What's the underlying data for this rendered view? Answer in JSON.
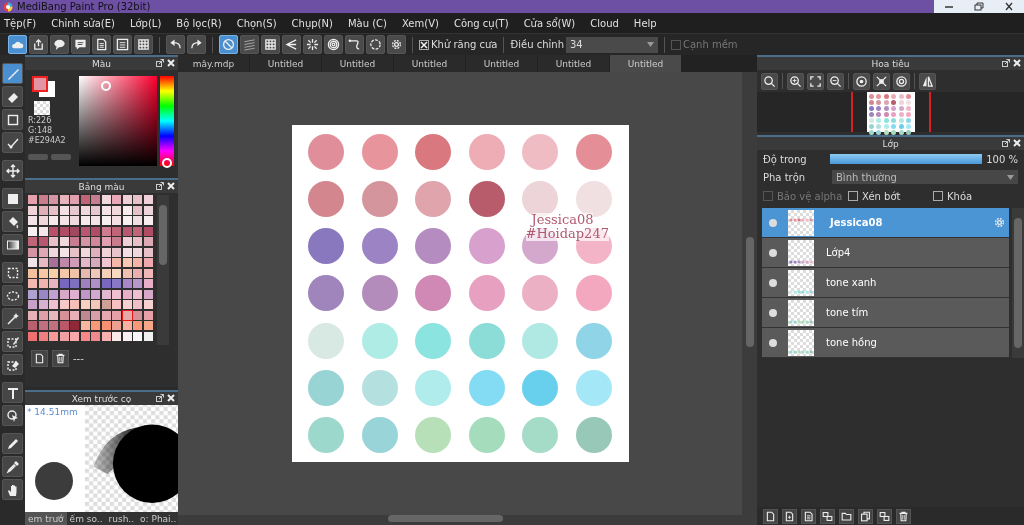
{
  "window": {
    "title": "MediBang Paint Pro (32bit)"
  },
  "menu": [
    "Tệp(F)",
    "Chỉnh sửa(E)",
    "Lớp(L)",
    "Bộ lọc(R)",
    "Chọn(S)",
    "Chụp(N)",
    "Màu (C)",
    "Xem(V)",
    "Công cụ(T)",
    "Cửa sổ(W)",
    "Cloud",
    "Help"
  ],
  "toolbar": {
    "buttons": [
      {
        "selected": true
      },
      {
        "selected": false
      },
      {
        "selected": false
      },
      {
        "selected": false
      },
      {
        "selected": false
      },
      {
        "selected": false
      },
      {
        "selected": false
      },
      {
        "selected": false
      },
      {
        "selected": false
      },
      {
        "selected": true
      },
      {
        "selected": false
      },
      {
        "selected": false
      },
      {
        "selected": false
      },
      {
        "selected": false
      },
      {
        "selected": false
      },
      {
        "selected": false
      },
      {
        "selected": false
      },
      {
        "selected": false
      }
    ],
    "antialias": {
      "label": "Khử răng cưa",
      "checked": true
    },
    "correction": {
      "label": "Điều chỉnh",
      "value": "34"
    },
    "soft_edge": {
      "label": "Cạnh mềm",
      "checked": false,
      "disabled": true
    }
  },
  "tools": [
    {
      "selected": true
    },
    {
      "selected": false
    },
    {
      "selected": false
    },
    {
      "selected": false
    },
    {
      "selected": false
    },
    {
      "selected": false
    },
    {
      "selected": false
    },
    {
      "selected": false
    },
    {
      "selected": false
    },
    {
      "selected": false
    },
    {
      "selected": false
    },
    {
      "selected": false
    },
    {
      "selected": false
    },
    {
      "selected": false
    },
    {
      "selected": false
    },
    {
      "selected": false
    },
    {
      "selected": false
    },
    {
      "selected": false
    }
  ],
  "color_panel": {
    "title": "Màu",
    "color": "#e294a2",
    "r": "R:226",
    "g": "G:148",
    "hex": "#E294A2"
  },
  "palette_panel": {
    "title": "Bảng màu",
    "footer": "---",
    "rows": [
      [
        {
          "color": "#e6a0ac",
          "selected": false
        },
        {
          "color": "#c87c8c",
          "selected": false
        },
        {
          "color": "#d494a4",
          "selected": false
        },
        {
          "color": "#e8b4bc",
          "selected": false
        },
        {
          "color": "#e0a0b0",
          "selected": false
        },
        {
          "color": "#c06478",
          "selected": false
        },
        {
          "color": "#c87c90",
          "selected": false
        },
        {
          "color": "#f0d8dc",
          "selected": false
        },
        {
          "color": "#e8a8b8",
          "selected": false
        },
        {
          "color": "#f0d0d8",
          "selected": false
        },
        {
          "color": "#e8c0c8",
          "selected": false
        },
        {
          "color": "#f0d0d8",
          "selected": false
        }
      ],
      [
        {
          "color": "#f0d4d8",
          "selected": false
        },
        {
          "color": "#e0b0b8",
          "selected": false
        },
        {
          "color": "#e8c0c8",
          "selected": false
        },
        {
          "color": "#f4e0e4",
          "selected": false
        },
        {
          "color": "#e8c8d0",
          "selected": false
        },
        {
          "color": "#f0d8dc",
          "selected": false
        },
        {
          "color": "#e8c8d0",
          "selected": false
        },
        {
          "color": "#f4e4e8",
          "selected": false
        },
        {
          "color": "#f0d8dc",
          "selected": false
        },
        {
          "color": "#f8ecee",
          "selected": false
        },
        {
          "color": "#e8c0c8",
          "selected": false
        },
        {
          "color": "#f0d4dc",
          "selected": false
        }
      ],
      [
        {
          "color": "#f4e4e8",
          "selected": false
        },
        {
          "color": "#f0d8dc",
          "selected": false
        },
        {
          "color": "#f8eaec",
          "selected": false
        },
        {
          "color": "#f4e4e8",
          "selected": false
        },
        {
          "color": "#f0dce0",
          "selected": false
        },
        {
          "color": "#f8eaec",
          "selected": false
        },
        {
          "color": "#f4e4e8",
          "selected": false
        },
        {
          "color": "#f8f0f0",
          "selected": false
        },
        {
          "color": "#f4e0e4",
          "selected": false
        },
        {
          "color": "#f8f0f2",
          "selected": false
        },
        {
          "color": "#f0e0e4",
          "selected": false
        },
        {
          "color": "#f8eef0",
          "selected": false
        }
      ],
      [
        {
          "color": "#f8f0f2",
          "selected": false
        },
        {
          "color": "#f4e8ea",
          "selected": false
        },
        {
          "color": "#b85068",
          "selected": false
        },
        {
          "color": "#b04c64",
          "selected": false
        },
        {
          "color": "#a04860",
          "selected": false
        },
        {
          "color": "#b85870",
          "selected": false
        },
        {
          "color": "#b04c64",
          "selected": false
        },
        {
          "color": "#d07c90",
          "selected": false
        },
        {
          "color": "#c06478",
          "selected": false
        },
        {
          "color": "#b85870",
          "selected": false
        },
        {
          "color": "#c06478",
          "selected": false
        },
        {
          "color": "#b04c64",
          "selected": false
        }
      ],
      [
        {
          "color": "#c06478",
          "selected": false
        },
        {
          "color": "#b85870",
          "selected": false
        },
        {
          "color": "#e8c0c8",
          "selected": false
        },
        {
          "color": "#f0d8dc",
          "selected": false
        },
        {
          "color": "#c87c90",
          "selected": false
        },
        {
          "color": "#d494a4",
          "selected": false
        },
        {
          "color": "#d08898",
          "selected": false
        },
        {
          "color": "#e0a0b0",
          "selected": false
        },
        {
          "color": "#c87c8c",
          "selected": false
        },
        {
          "color": "#f0d0d8",
          "selected": false
        },
        {
          "color": "#e8c0c8",
          "selected": false
        },
        {
          "color": "#e0a8b4",
          "selected": false
        }
      ],
      [
        {
          "color": "#d494a4",
          "selected": false
        },
        {
          "color": "#e0a8b4",
          "selected": false
        },
        {
          "color": "#f0d8dc",
          "selected": false
        },
        {
          "color": "#f4e4e8",
          "selected": false
        },
        {
          "color": "#e8c0c8",
          "selected": false
        },
        {
          "color": "#f0d8dc",
          "selected": false
        },
        {
          "color": "#e0b0bc",
          "selected": false
        },
        {
          "color": "#f0d4d8",
          "selected": false
        },
        {
          "color": "#e8c4cc",
          "selected": false
        },
        {
          "color": "#f4e0e4",
          "selected": false
        },
        {
          "color": "#f0d8dc",
          "selected": false
        },
        {
          "color": "#e8c0c8",
          "selected": false
        }
      ],
      [
        {
          "color": "#f0e4e8",
          "selected": false
        },
        {
          "color": "#e8b8c4",
          "selected": false
        },
        {
          "color": "#a87098",
          "selected": false
        },
        {
          "color": "#c088a8",
          "selected": false
        },
        {
          "color": "#d09cb8",
          "selected": false
        },
        {
          "color": "#e4b8c8",
          "selected": false
        },
        {
          "color": "#d8a8bc",
          "selected": false
        },
        {
          "color": "#f0c4d0",
          "selected": false
        },
        {
          "color": "#f4b8a8",
          "selected": false
        },
        {
          "color": "#f8c8b4",
          "selected": false
        },
        {
          "color": "#f4b4a8",
          "selected": false
        },
        {
          "color": "#f0a8b0",
          "selected": false
        }
      ],
      [
        {
          "color": "#f4c0a0",
          "selected": false
        },
        {
          "color": "#f8c8a4",
          "selected": false
        },
        {
          "color": "#f8d0a8",
          "selected": false
        },
        {
          "color": "#f4c8a8",
          "selected": false
        },
        {
          "color": "#f0c4a8",
          "selected": false
        },
        {
          "color": "#e8b8b0",
          "selected": false
        },
        {
          "color": "#f0c8b8",
          "selected": false
        },
        {
          "color": "#f4d0b8",
          "selected": false
        },
        {
          "color": "#f8d8c0",
          "selected": false
        },
        {
          "color": "#f0c0b0",
          "selected": false
        },
        {
          "color": "#e8b0b0",
          "selected": false
        },
        {
          "color": "#f0b8b8",
          "selected": false
        }
      ],
      [
        {
          "color": "#f4b8b0",
          "selected": false
        },
        {
          "color": "#f0b4b0",
          "selected": false
        },
        {
          "color": "#e8b4c0",
          "selected": false
        },
        {
          "color": "#7868c0",
          "selected": false
        },
        {
          "color": "#8070c0",
          "selected": false
        },
        {
          "color": "#a080c0",
          "selected": false
        },
        {
          "color": "#b090c8",
          "selected": false
        },
        {
          "color": "#7868c0",
          "selected": false
        },
        {
          "color": "#8878c8",
          "selected": false
        },
        {
          "color": "#a888c8",
          "selected": false
        },
        {
          "color": "#b898c8",
          "selected": false
        },
        {
          "color": "#e8b0c8",
          "selected": false
        }
      ],
      [
        {
          "color": "#b0a0d0",
          "selected": false
        },
        {
          "color": "#9888c8",
          "selected": false
        },
        {
          "color": "#c0a0d0",
          "selected": false
        },
        {
          "color": "#d8a8c8",
          "selected": false
        },
        {
          "color": "#e0b0d0",
          "selected": false
        },
        {
          "color": "#c098c8",
          "selected": false
        },
        {
          "color": "#d0a8d0",
          "selected": false
        },
        {
          "color": "#e0b8d0",
          "selected": false
        },
        {
          "color": "#f0c0d0",
          "selected": false
        },
        {
          "color": "#e8b0c8",
          "selected": false
        },
        {
          "color": "#f0c0d0",
          "selected": false
        },
        {
          "color": "#d8a8c8",
          "selected": false
        }
      ],
      [
        {
          "color": "#c8a0c8",
          "selected": false
        },
        {
          "color": "#d8b0d0",
          "selected": false
        },
        {
          "color": "#f0c0d0",
          "selected": false
        },
        {
          "color": "#f8c8c8",
          "selected": false
        },
        {
          "color": "#f4c0b8",
          "selected": false
        },
        {
          "color": "#f8d0c0",
          "selected": false
        },
        {
          "color": "#f4c8b8",
          "selected": false
        },
        {
          "color": "#d0a098",
          "selected": false
        },
        {
          "color": "#f8c0c0",
          "selected": false
        },
        {
          "color": "#f8d0d0",
          "selected": false
        },
        {
          "color": "#f0c0c8",
          "selected": false
        },
        {
          "color": "#f8d0d0",
          "selected": false
        }
      ],
      [
        {
          "color": "#e8b0b8",
          "selected": false
        },
        {
          "color": "#e0a0a8",
          "selected": false
        },
        {
          "color": "#e8b8c0",
          "selected": false
        },
        {
          "color": "#d89098",
          "selected": false
        },
        {
          "color": "#e8b0b8",
          "selected": false
        },
        {
          "color": "#c08890",
          "selected": false
        },
        {
          "color": "#d8a0a8",
          "selected": false
        },
        {
          "color": "#e8a8b0",
          "selected": false
        },
        {
          "color": "#e8a0a8",
          "selected": false
        },
        {
          "color": "#e8a8a8",
          "selected": true
        },
        {
          "color": "#d89098",
          "selected": false
        },
        {
          "color": "#e8a0a8",
          "selected": false
        }
      ],
      [
        {
          "color": "#b8606c",
          "selected": false
        },
        {
          "color": "#c07080",
          "selected": false
        },
        {
          "color": "#c07080",
          "selected": false
        },
        {
          "color": "#b85868",
          "selected": false
        },
        {
          "color": "#902838",
          "selected": false
        },
        {
          "color": "#f8b8a0",
          "selected": false
        },
        {
          "color": "#f89878",
          "selected": false
        },
        {
          "color": "#f89070",
          "selected": false
        },
        {
          "color": "#f0a090",
          "selected": false
        },
        {
          "color": "#f8b0a0",
          "selected": false
        },
        {
          "color": "#f89878",
          "selected": false
        },
        {
          "color": "#f8a888",
          "selected": false
        }
      ],
      [
        {
          "color": "#f07070",
          "selected": false
        },
        {
          "color": "#f08080",
          "selected": false
        },
        {
          "color": "#f89898",
          "selected": false
        },
        {
          "color": "#f0a0a0",
          "selected": false
        },
        {
          "color": "#f8a8a8",
          "selected": false
        },
        {
          "color": "#f88888",
          "selected": false
        },
        {
          "color": "#f08890",
          "selected": false
        },
        {
          "color": "#f8b0b0",
          "selected": false
        },
        {
          "color": "#f8e8e8",
          "selected": false
        },
        {
          "color": "#f8f0f0",
          "selected": false
        },
        {
          "color": "#f8f8f8",
          "selected": false
        },
        {
          "color": "#f0f0f0",
          "selected": false
        }
      ]
    ]
  },
  "brush_preview": {
    "title": "Xem trước cọ",
    "size": "* 14.51mm"
  },
  "left_tabs": [
    {
      "label": "em trướ",
      "selected": true
    },
    {
      "label": "ếm so..",
      "selected": false
    },
    {
      "label": "rush..",
      "selected": false
    },
    {
      "label": "o: Phai..",
      "selected": false
    }
  ],
  "documents": [
    {
      "label": "mây.mdp",
      "selected": false
    },
    {
      "label": "Untitled",
      "selected": false
    },
    {
      "label": "Untitled",
      "selected": false
    },
    {
      "label": "Untitled",
      "selected": false
    },
    {
      "label": "Untitled",
      "selected": false
    },
    {
      "label": "Untitled",
      "selected": false
    },
    {
      "label": "Untitled",
      "selected": true
    }
  ],
  "canvas": {
    "signature": [
      "Jessica08",
      "#Hoidap247"
    ],
    "dots": [
      [
        {
          "color": "#e08e9a"
        },
        {
          "color": "#e8949c"
        },
        {
          "color": "#d9787f"
        },
        {
          "color": "#eeacb4"
        },
        {
          "color": "#f0bcc4"
        },
        {
          "color": "#e48e98"
        }
      ],
      [
        {
          "color": "#d4868f"
        },
        {
          "color": "#d4969c"
        },
        {
          "color": "#e0a4ac"
        },
        {
          "color": "#b85c6c"
        },
        {
          "color": "#ecd4d8"
        },
        {
          "color": "#f0e0e2"
        }
      ],
      [
        {
          "color": "#8a78be"
        },
        {
          "color": "#9c84c4"
        },
        {
          "color": "#b48cc0"
        },
        {
          "color": "#d8a0cc"
        },
        {
          "color": "#d4a8cc"
        },
        {
          "color": "#f4b4c8"
        }
      ],
      [
        {
          "color": "#a084bc"
        },
        {
          "color": "#b48cbc"
        },
        {
          "color": "#d088b4"
        },
        {
          "color": "#e8a0c0"
        },
        {
          "color": "#ecb0c4"
        },
        {
          "color": "#f4a8c0"
        }
      ],
      [
        {
          "color": "#d8e8e2"
        },
        {
          "color": "#b0ece6"
        },
        {
          "color": "#8ce4e0"
        },
        {
          "color": "#8cdcd8"
        },
        {
          "color": "#b0e8e4"
        },
        {
          "color": "#90d4e8"
        }
      ],
      [
        {
          "color": "#98d4d4"
        },
        {
          "color": "#b4e0e0"
        },
        {
          "color": "#b0ecec"
        },
        {
          "color": "#84dcf4"
        },
        {
          "color": "#68d0ec"
        },
        {
          "color": "#a4e8f8"
        }
      ],
      [
        {
          "color": "#9cd8cc"
        },
        {
          "color": "#98d4d8"
        },
        {
          "color": "#b8e0b8"
        },
        {
          "color": "#a4dcbc"
        },
        {
          "color": "#a4dcc8"
        },
        {
          "color": "#98c8b8"
        }
      ]
    ]
  },
  "navigator": {
    "title": "Hoa tiêu"
  },
  "layers_panel": {
    "title": "Lớp",
    "opacity": {
      "label": "Độ trong",
      "level": 1,
      "value": "100 %"
    },
    "blend": {
      "label": "Pha trộn",
      "value": "Bình thường"
    },
    "options": [
      {
        "label": "Bảo vệ alpha",
        "checked": false,
        "disabled": true
      },
      {
        "label": "Xén bớt",
        "checked": false,
        "disabled": false
      },
      {
        "label": "Khóa",
        "checked": false,
        "disabled": false
      }
    ],
    "layers": [
      {
        "name": "Jessica08",
        "selected": true,
        "visible": true
      },
      {
        "name": "Lớp4",
        "selected": false,
        "visible": true
      },
      {
        "name": "tone xanh",
        "selected": false,
        "visible": true
      },
      {
        "name": "tone tím",
        "selected": false,
        "visible": true
      },
      {
        "name": "tone hồng",
        "selected": false,
        "visible": true
      }
    ]
  }
}
